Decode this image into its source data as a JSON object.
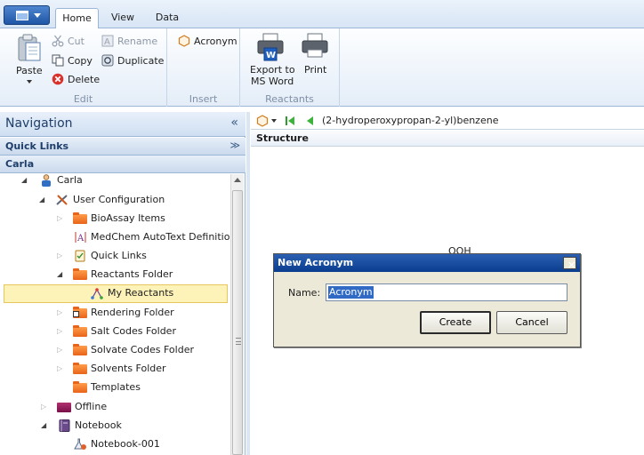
{
  "ribbon": {
    "tabs": [
      {
        "label": "Home",
        "active": true
      },
      {
        "label": "View",
        "active": false
      },
      {
        "label": "Data",
        "active": false
      }
    ],
    "groups": {
      "edit": {
        "label": "Edit",
        "paste": "Paste",
        "cut": "Cut",
        "copy": "Copy",
        "delete": "Delete",
        "rename": "Rename",
        "duplicate": "Duplicate"
      },
      "insert": {
        "label": "Insert",
        "acronym": "Acronym"
      },
      "reactants": {
        "label": "Reactants",
        "export_line1": "Export to",
        "export_line2": "MS Word",
        "print": "Print"
      }
    }
  },
  "navigation": {
    "title": "Navigation",
    "collapse_glyph": "«",
    "quick_links": "Quick Links",
    "quick_links_glyph": "≫",
    "section": "Carla",
    "tree": [
      {
        "label": "Carla",
        "expander": "open",
        "icon": "user-icon"
      },
      {
        "label": "User Configuration",
        "expander": "open",
        "icon": "tools-icon"
      },
      {
        "label": "BioAssay Items",
        "expander": "closed",
        "icon": "folder-icon"
      },
      {
        "label": "MedChem AutoText Definitions",
        "expander": "none",
        "icon": "autotext-icon"
      },
      {
        "label": "Quick Links",
        "expander": "closed",
        "icon": "quicklinks-icon"
      },
      {
        "label": "Reactants Folder",
        "expander": "open",
        "icon": "folder-icon"
      },
      {
        "label": "My Reactants",
        "expander": "none",
        "icon": "reactants-icon",
        "selected": true
      },
      {
        "label": "Rendering Folder",
        "expander": "closed",
        "icon": "rendering-folder-icon"
      },
      {
        "label": "Salt Codes Folder",
        "expander": "closed",
        "icon": "folder-icon"
      },
      {
        "label": "Solvate Codes Folder",
        "expander": "closed",
        "icon": "folder-icon"
      },
      {
        "label": "Solvents Folder",
        "expander": "closed",
        "icon": "folder-icon"
      },
      {
        "label": "Templates",
        "expander": "none",
        "icon": "folder-icon"
      },
      {
        "label": "Offline",
        "expander": "closed",
        "icon": "offline-folder-icon"
      },
      {
        "label": "Notebook",
        "expander": "open",
        "icon": "notebook-icon"
      },
      {
        "label": "Notebook-001",
        "expander": "none",
        "icon": "experiment-icon"
      }
    ]
  },
  "content": {
    "molecule_name": "(2-hydroperoxypropan-2-yl)benzene",
    "structure_header": "Structure",
    "structure_fragment": "OOH"
  },
  "dialog": {
    "title": "New Acronym",
    "close_glyph": "✕",
    "name_label": "Name:",
    "name_value": "Acronym",
    "create": "Create",
    "cancel": "Cancel"
  },
  "colors": {
    "ribbon_accent": "#1f56a6",
    "selection_bg": "#fdf3b8",
    "dialog_title": "#0a3d8e"
  }
}
